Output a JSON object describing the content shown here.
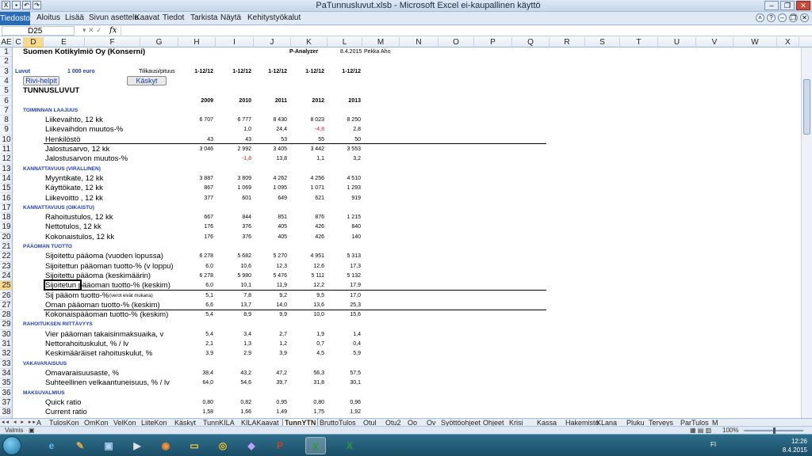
{
  "window": {
    "title": "PaTunnusluvut.xlsb - Microsoft Excel ei-kaupallinen käyttö"
  },
  "ribbon": {
    "tabs": [
      "Tiedosto",
      "Aloitus",
      "Lisää",
      "Sivun asettelu",
      "Kaavat",
      "Tiedot",
      "Tarkista",
      "Näytä",
      "Kehitystyökalut"
    ]
  },
  "formula_bar": {
    "name_box": "D25",
    "fx": "fx",
    "value": ""
  },
  "columns": [
    "AE",
    "C",
    "D",
    "E",
    "F",
    "G",
    "H",
    "I",
    "J",
    "K",
    "L",
    "M",
    "N",
    "O",
    "P",
    "Q",
    "R",
    "S",
    "T",
    "U",
    "V",
    "W",
    "X"
  ],
  "rows": [
    "1",
    "2",
    "3",
    "4",
    "5",
    "6",
    "7",
    "8",
    "9",
    "10",
    "11",
    "12",
    "13",
    "14",
    "15",
    "16",
    "17",
    "18",
    "19",
    "20",
    "21",
    "22",
    "23",
    "24",
    "25",
    "26",
    "27",
    "28",
    "29",
    "30",
    "31",
    "32",
    "33",
    "34",
    "35",
    "36",
    "37",
    "38"
  ],
  "sheet": {
    "company": "Suomen Kotikylmiö Oy (Konserni)",
    "p_analyzer": "P-Analyzer",
    "date": "8.4.2015",
    "author": "Pekka Aho",
    "luvut_label": "Luvut",
    "luvut_value": "1 000 euro",
    "tilikausi_label": "Tilikausi/pituus",
    "periods": [
      "1-12/12",
      "1-12/12",
      "1-12/12",
      "1-12/12",
      "1-12/12"
    ],
    "rivi_helpit": "Rivi-helpit",
    "kaskyt": "Käskyt",
    "heading": "TUNNUSLUVUT",
    "years": [
      "2009",
      "2010",
      "2011",
      "2012",
      "2013"
    ],
    "data_rows": [
      {
        "type": "section",
        "label": "TOIMINNAN LAAJUUS"
      },
      {
        "label": "Liikevaihto, 12 kk",
        "values": [
          "6 707",
          "6 777",
          "8 430",
          "8 023",
          "8 250"
        ]
      },
      {
        "label": "Liikevaihdon muutos-%",
        "values": [
          "",
          "1,0",
          "24,4",
          "-4,8",
          "2,8"
        ]
      },
      {
        "label": "Henkilöstö",
        "values": [
          "43",
          "43",
          "53",
          "55",
          "50"
        ]
      },
      {
        "label": "Jalostusarvo, 12 kk",
        "values": [
          "3 046",
          "2 992",
          "3 405",
          "3 442",
          "3 553"
        ]
      },
      {
        "label": "Jalostusarvon muutos-%",
        "values": [
          "",
          "-1,8",
          "13,8",
          "1,1",
          "3,2"
        ]
      },
      {
        "type": "section",
        "label": "KANNATTAVUUS (VIRALLINEN)"
      },
      {
        "label": "Myyntikate, 12 kk",
        "values": [
          "3 887",
          "3 809",
          "4 262",
          "4 256",
          "4 510"
        ]
      },
      {
        "label": "Käyttökate, 12 kk",
        "values": [
          "867",
          "1 069",
          "1 095",
          "1 071",
          "1 293"
        ]
      },
      {
        "label": "Liikevoitto , 12 kk",
        "values": [
          "377",
          "601",
          "649",
          "621",
          "919"
        ]
      },
      {
        "type": "section",
        "label": "KANNATTAVUUS (OIKAISTU)"
      },
      {
        "label": "Rahoitustulos, 12 kk",
        "values": [
          "667",
          "844",
          "851",
          "876",
          "1 215"
        ]
      },
      {
        "label": "Nettotulos, 12 kk",
        "values": [
          "176",
          "376",
          "405",
          "426",
          "840"
        ]
      },
      {
        "label": "Kokonaistulos, 12 kk",
        "values": [
          "176",
          "376",
          "405",
          "426",
          "140"
        ]
      },
      {
        "type": "section",
        "label": "PÄÄOMAN TUOTTO"
      },
      {
        "label": "Sijoitettu pääoma (vuoden lopussa)",
        "values": [
          "6 278",
          "5 682",
          "5 270",
          "4 951",
          "5 313"
        ]
      },
      {
        "label": "Sijoitettun pääoman tuotto-% (v loppu)",
        "values": [
          "6,0",
          "10,6",
          "12,3",
          "12,6",
          "17,3"
        ]
      },
      {
        "label": "Sijoitettu pääoma (keskimäärin)",
        "values": [
          "6 278",
          "5 980",
          "5 476",
          "5 111",
          "5 132"
        ]
      },
      {
        "label": "Sijoitetun pääoman tuotto-% (keskim)",
        "values": [
          "6,0",
          "10,1",
          "11,9",
          "12,2",
          "17,9"
        ]
      },
      {
        "label": "Sij pääom tuotto-%",
        "note": "(verot eivät mukana)",
        "values": [
          "5,1",
          "7,8",
          "9,2",
          "9,5",
          "17,0"
        ]
      },
      {
        "label": "Oman pääoman tuotto-% (keskim)",
        "values": [
          "6,6",
          "13,7",
          "14,0",
          "13,6",
          "25,3"
        ]
      },
      {
        "label": "Kokonaispääoman tuotto-% (keskim)",
        "values": [
          "5,4",
          "8,9",
          "9,9",
          "10,0",
          "15,6"
        ]
      },
      {
        "type": "section",
        "label": "RAHOITUKSEN RIITTÄVYYS"
      },
      {
        "label": "Vier pääoman takaisinmaksuaika, v",
        "values": [
          "5,4",
          "3,4",
          "2,7",
          "1,9",
          "1,4"
        ]
      },
      {
        "label": "Nettorahoituskulut, % / lv",
        "values": [
          "2,1",
          "1,3",
          "1,2",
          "0,7",
          "0,4"
        ]
      },
      {
        "label": "Keskimääräiset rahoituskulut, %",
        "values": [
          "3,9",
          "2,9",
          "3,9",
          "4,5",
          "5,9"
        ]
      },
      {
        "type": "section",
        "label": "VAKAVARAISUUS"
      },
      {
        "label": "Omavaraisuusaste, %",
        "values": [
          "38,4",
          "43,2",
          "47,2",
          "56,3",
          "57,5"
        ]
      },
      {
        "label": "Suhteellinen velkaantuneisuus, % / lv",
        "values": [
          "64,0",
          "54,6",
          "39,7",
          "31,8",
          "30,1"
        ]
      },
      {
        "type": "section",
        "label": "MAKSUVALMIUS"
      },
      {
        "label": "Quick ratio",
        "values": [
          "0,80",
          "0,82",
          "0,95",
          "0,80",
          "0,96"
        ]
      },
      {
        "label": "Current ratio",
        "values": [
          "1,58",
          "1,66",
          "1,49",
          "1,75",
          "1,92"
        ]
      }
    ]
  },
  "sheet_tabs": [
    "A",
    "TulosKon",
    "OmKon",
    "VelKon",
    "LiiteKon",
    "Käskyt",
    "TunnKILA",
    "KILAKaavat",
    "TunnYTN",
    "BruttoTulos",
    "Otul",
    "Otu2",
    "Oo",
    "Ov",
    "Syöttöohjeet",
    "Ohjeet",
    "Krisi",
    "Kassa",
    "Hakemisto",
    "KLana",
    "Pluku",
    "Terveys",
    "ParTulos",
    "M"
  ],
  "active_sheet": "TunnYTN",
  "status": {
    "mode": "Valmis",
    "zoom": "100%"
  },
  "taskbar": {
    "time": "12:26",
    "date": "8.4.2015",
    "lang": "FI"
  }
}
